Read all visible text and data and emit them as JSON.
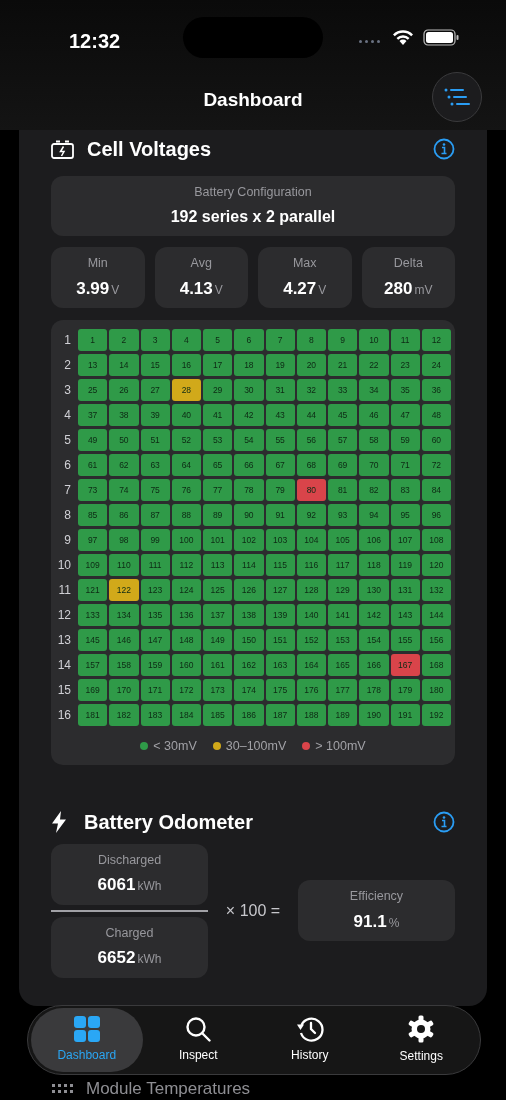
{
  "status_bar": {
    "time": "12:32"
  },
  "nav": {
    "title": "Dashboard"
  },
  "cell_voltages": {
    "title": "Cell Voltages",
    "configuration": {
      "label": "Battery Configuration",
      "value": "192 series x 2 parallel"
    },
    "stats": [
      {
        "label": "Min",
        "value": "3.99",
        "unit": "V"
      },
      {
        "label": "Avg",
        "value": "4.13",
        "unit": "V"
      },
      {
        "label": "Max",
        "value": "4.27",
        "unit": "V"
      },
      {
        "label": "Delta",
        "value": "280",
        "unit": "mV"
      }
    ],
    "grid": {
      "rows": [
        {
          "label": "1",
          "cells": [
            {
              "label": "1",
              "color": "#2f9a48"
            },
            {
              "label": "2",
              "color": "#2f9a48"
            },
            {
              "label": "3",
              "color": "#2f9a48"
            },
            {
              "label": "4",
              "color": "#2f9a48"
            },
            {
              "label": "5",
              "color": "#2f9a48"
            },
            {
              "label": "6",
              "color": "#2f9a48"
            },
            {
              "label": "7",
              "color": "#2f9a48"
            },
            {
              "label": "8",
              "color": "#2f9a48"
            },
            {
              "label": "9",
              "color": "#2f9a48"
            },
            {
              "label": "10",
              "color": "#2f9a48"
            },
            {
              "label": "11",
              "color": "#2f9a48"
            },
            {
              "label": "12",
              "color": "#2f9a48"
            }
          ]
        },
        {
          "label": "2",
          "cells": [
            {
              "label": "13",
              "color": "#2f9a48"
            },
            {
              "label": "14",
              "color": "#2f9a48"
            },
            {
              "label": "15",
              "color": "#2f9a48"
            },
            {
              "label": "16",
              "color": "#2f9a48"
            },
            {
              "label": "17",
              "color": "#2f9a48"
            },
            {
              "label": "18",
              "color": "#2f9a48"
            },
            {
              "label": "19",
              "color": "#2f9a48"
            },
            {
              "label": "20",
              "color": "#2f9a48"
            },
            {
              "label": "21",
              "color": "#2f9a48"
            },
            {
              "label": "22",
              "color": "#2f9a48"
            },
            {
              "label": "23",
              "color": "#2f9a48"
            },
            {
              "label": "24",
              "color": "#2f9a48"
            }
          ]
        },
        {
          "label": "3",
          "cells": [
            {
              "label": "25",
              "color": "#2f9a48"
            },
            {
              "label": "26",
              "color": "#2f9a48"
            },
            {
              "label": "27",
              "color": "#2f9a48"
            },
            {
              "label": "28",
              "color": "#d1a91a"
            },
            {
              "label": "29",
              "color": "#2f9a48"
            },
            {
              "label": "30",
              "color": "#2f9a48"
            },
            {
              "label": "31",
              "color": "#2f9a48"
            },
            {
              "label": "32",
              "color": "#2f9a48"
            },
            {
              "label": "33",
              "color": "#2f9a48"
            },
            {
              "label": "34",
              "color": "#2f9a48"
            },
            {
              "label": "35",
              "color": "#2f9a48"
            },
            {
              "label": "36",
              "color": "#2f9a48"
            }
          ]
        },
        {
          "label": "4",
          "cells": [
            {
              "label": "37",
              "color": "#2f9a48"
            },
            {
              "label": "38",
              "color": "#2f9a48"
            },
            {
              "label": "39",
              "color": "#2f9a48"
            },
            {
              "label": "40",
              "color": "#2f9a48"
            },
            {
              "label": "41",
              "color": "#2f9a48"
            },
            {
              "label": "42",
              "color": "#2f9a48"
            },
            {
              "label": "43",
              "color": "#2f9a48"
            },
            {
              "label": "44",
              "color": "#2f9a48"
            },
            {
              "label": "45",
              "color": "#2f9a48"
            },
            {
              "label": "46",
              "color": "#2f9a48"
            },
            {
              "label": "47",
              "color": "#2f9a48"
            },
            {
              "label": "48",
              "color": "#2f9a48"
            }
          ]
        },
        {
          "label": "5",
          "cells": [
            {
              "label": "49",
              "color": "#2f9a48"
            },
            {
              "label": "50",
              "color": "#2f9a48"
            },
            {
              "label": "51",
              "color": "#2f9a48"
            },
            {
              "label": "52",
              "color": "#2f9a48"
            },
            {
              "label": "53",
              "color": "#2f9a48"
            },
            {
              "label": "54",
              "color": "#2f9a48"
            },
            {
              "label": "55",
              "color": "#2f9a48"
            },
            {
              "label": "56",
              "color": "#2f9a48"
            },
            {
              "label": "57",
              "color": "#2f9a48"
            },
            {
              "label": "58",
              "color": "#2f9a48"
            },
            {
              "label": "59",
              "color": "#2f9a48"
            },
            {
              "label": "60",
              "color": "#2f9a48"
            }
          ]
        },
        {
          "label": "6",
          "cells": [
            {
              "label": "61",
              "color": "#2f9a48"
            },
            {
              "label": "62",
              "color": "#2f9a48"
            },
            {
              "label": "63",
              "color": "#2f9a48"
            },
            {
              "label": "64",
              "color": "#2f9a48"
            },
            {
              "label": "65",
              "color": "#2f9a48"
            },
            {
              "label": "66",
              "color": "#2f9a48"
            },
            {
              "label": "67",
              "color": "#2f9a48"
            },
            {
              "label": "68",
              "color": "#2f9a48"
            },
            {
              "label": "69",
              "color": "#2f9a48"
            },
            {
              "label": "70",
              "color": "#2f9a48"
            },
            {
              "label": "71",
              "color": "#2f9a48"
            },
            {
              "label": "72",
              "color": "#2f9a48"
            }
          ]
        },
        {
          "label": "7",
          "cells": [
            {
              "label": "73",
              "color": "#2f9a48"
            },
            {
              "label": "74",
              "color": "#2f9a48"
            },
            {
              "label": "75",
              "color": "#2f9a48"
            },
            {
              "label": "76",
              "color": "#2f9a48"
            },
            {
              "label": "77",
              "color": "#2f9a48"
            },
            {
              "label": "78",
              "color": "#2f9a48"
            },
            {
              "label": "79",
              "color": "#2f9a48"
            },
            {
              "label": "80",
              "color": "#d9444a"
            },
            {
              "label": "81",
              "color": "#2f9a48"
            },
            {
              "label": "82",
              "color": "#2f9a48"
            },
            {
              "label": "83",
              "color": "#2f9a48"
            },
            {
              "label": "84",
              "color": "#2f9a48"
            }
          ]
        },
        {
          "label": "8",
          "cells": [
            {
              "label": "85",
              "color": "#2f9a48"
            },
            {
              "label": "86",
              "color": "#2f9a48"
            },
            {
              "label": "87",
              "color": "#2f9a48"
            },
            {
              "label": "88",
              "color": "#2f9a48"
            },
            {
              "label": "89",
              "color": "#2f9a48"
            },
            {
              "label": "90",
              "color": "#2f9a48"
            },
            {
              "label": "91",
              "color": "#2f9a48"
            },
            {
              "label": "92",
              "color": "#2f9a48"
            },
            {
              "label": "93",
              "color": "#2f9a48"
            },
            {
              "label": "94",
              "color": "#2f9a48"
            },
            {
              "label": "95",
              "color": "#2f9a48"
            },
            {
              "label": "96",
              "color": "#2f9a48"
            }
          ]
        },
        {
          "label": "9",
          "cells": [
            {
              "label": "97",
              "color": "#2f9a48"
            },
            {
              "label": "98",
              "color": "#2f9a48"
            },
            {
              "label": "99",
              "color": "#2f9a48"
            },
            {
              "label": "100",
              "color": "#2f9a48"
            },
            {
              "label": "101",
              "color": "#2f9a48"
            },
            {
              "label": "102",
              "color": "#2f9a48"
            },
            {
              "label": "103",
              "color": "#2f9a48"
            },
            {
              "label": "104",
              "color": "#2f9a48"
            },
            {
              "label": "105",
              "color": "#2f9a48"
            },
            {
              "label": "106",
              "color": "#2f9a48"
            },
            {
              "label": "107",
              "color": "#2f9a48"
            },
            {
              "label": "108",
              "color": "#2f9a48"
            }
          ]
        },
        {
          "label": "10",
          "cells": [
            {
              "label": "109",
              "color": "#2f9a48"
            },
            {
              "label": "110",
              "color": "#2f9a48"
            },
            {
              "label": "111",
              "color": "#2f9a48"
            },
            {
              "label": "112",
              "color": "#2f9a48"
            },
            {
              "label": "113",
              "color": "#2f9a48"
            },
            {
              "label": "114",
              "color": "#2f9a48"
            },
            {
              "label": "115",
              "color": "#2f9a48"
            },
            {
              "label": "116",
              "color": "#2f9a48"
            },
            {
              "label": "117",
              "color": "#2f9a48"
            },
            {
              "label": "118",
              "color": "#2f9a48"
            },
            {
              "label": "119",
              "color": "#2f9a48"
            },
            {
              "label": "120",
              "color": "#2f9a48"
            }
          ]
        },
        {
          "label": "11",
          "cells": [
            {
              "label": "121",
              "color": "#2f9a48"
            },
            {
              "label": "122",
              "color": "#d1a91a"
            },
            {
              "label": "123",
              "color": "#2f9a48"
            },
            {
              "label": "124",
              "color": "#2f9a48"
            },
            {
              "label": "125",
              "color": "#2f9a48"
            },
            {
              "label": "126",
              "color": "#2f9a48"
            },
            {
              "label": "127",
              "color": "#2f9a48"
            },
            {
              "label": "128",
              "color": "#2f9a48"
            },
            {
              "label": "129",
              "color": "#2f9a48"
            },
            {
              "label": "130",
              "color": "#2f9a48"
            },
            {
              "label": "131",
              "color": "#2f9a48"
            },
            {
              "label": "132",
              "color": "#2f9a48"
            }
          ]
        },
        {
          "label": "12",
          "cells": [
            {
              "label": "133",
              "color": "#2f9a48"
            },
            {
              "label": "134",
              "color": "#2f9a48"
            },
            {
              "label": "135",
              "color": "#2f9a48"
            },
            {
              "label": "136",
              "color": "#2f9a48"
            },
            {
              "label": "137",
              "color": "#2f9a48"
            },
            {
              "label": "138",
              "color": "#2f9a48"
            },
            {
              "label": "139",
              "color": "#2f9a48"
            },
            {
              "label": "140",
              "color": "#2f9a48"
            },
            {
              "label": "141",
              "color": "#2f9a48"
            },
            {
              "label": "142",
              "color": "#2f9a48"
            },
            {
              "label": "143",
              "color": "#2f9a48"
            },
            {
              "label": "144",
              "color": "#2f9a48"
            }
          ]
        },
        {
          "label": "13",
          "cells": [
            {
              "label": "145",
              "color": "#2f9a48"
            },
            {
              "label": "146",
              "color": "#2f9a48"
            },
            {
              "label": "147",
              "color": "#2f9a48"
            },
            {
              "label": "148",
              "color": "#2f9a48"
            },
            {
              "label": "149",
              "color": "#2f9a48"
            },
            {
              "label": "150",
              "color": "#2f9a48"
            },
            {
              "label": "151",
              "color": "#2f9a48"
            },
            {
              "label": "152",
              "color": "#2f9a48"
            },
            {
              "label": "153",
              "color": "#2f9a48"
            },
            {
              "label": "154",
              "color": "#2f9a48"
            },
            {
              "label": "155",
              "color": "#2f9a48"
            },
            {
              "label": "156",
              "color": "#2f9a48"
            }
          ]
        },
        {
          "label": "14",
          "cells": [
            {
              "label": "157",
              "color": "#2f9a48"
            },
            {
              "label": "158",
              "color": "#2f9a48"
            },
            {
              "label": "159",
              "color": "#2f9a48"
            },
            {
              "label": "160",
              "color": "#2f9a48"
            },
            {
              "label": "161",
              "color": "#2f9a48"
            },
            {
              "label": "162",
              "color": "#2f9a48"
            },
            {
              "label": "163",
              "color": "#2f9a48"
            },
            {
              "label": "164",
              "color": "#2f9a48"
            },
            {
              "label": "165",
              "color": "#2f9a48"
            },
            {
              "label": "166",
              "color": "#2f9a48"
            },
            {
              "label": "167",
              "color": "#d9444a"
            },
            {
              "label": "168",
              "color": "#2f9a48"
            }
          ]
        },
        {
          "label": "15",
          "cells": [
            {
              "label": "169",
              "color": "#2f9a48"
            },
            {
              "label": "170",
              "color": "#2f9a48"
            },
            {
              "label": "171",
              "color": "#2f9a48"
            },
            {
              "label": "172",
              "color": "#2f9a48"
            },
            {
              "label": "173",
              "color": "#2f9a48"
            },
            {
              "label": "174",
              "color": "#2f9a48"
            },
            {
              "label": "175",
              "color": "#2f9a48"
            },
            {
              "label": "176",
              "color": "#2f9a48"
            },
            {
              "label": "177",
              "color": "#2f9a48"
            },
            {
              "label": "178",
              "color": "#2f9a48"
            },
            {
              "label": "179",
              "color": "#2f9a48"
            },
            {
              "label": "180",
              "color": "#2f9a48"
            }
          ]
        },
        {
          "label": "16",
          "cells": [
            {
              "label": "181",
              "color": "#2f9a48"
            },
            {
              "label": "182",
              "color": "#2f9a48"
            },
            {
              "label": "183",
              "color": "#2f9a48"
            },
            {
              "label": "184",
              "color": "#2f9a48"
            },
            {
              "label": "185",
              "color": "#2f9a48"
            },
            {
              "label": "186",
              "color": "#2f9a48"
            },
            {
              "label": "187",
              "color": "#2f9a48"
            },
            {
              "label": "188",
              "color": "#2f9a48"
            },
            {
              "label": "189",
              "color": "#2f9a48"
            },
            {
              "label": "190",
              "color": "#2f9a48"
            },
            {
              "label": "191",
              "color": "#2f9a48"
            },
            {
              "label": "192",
              "color": "#2f9a48"
            }
          ]
        }
      ],
      "legend": [
        {
          "label": "< 30mV",
          "color": "#2f9a48"
        },
        {
          "label": "30–100mV",
          "color": "#d1a91a"
        },
        {
          "label": "> 100mV",
          "color": "#d9444a"
        }
      ]
    }
  },
  "odometer": {
    "title": "Battery Odometer",
    "discharged": {
      "label": "Discharged",
      "value": "6061",
      "unit": "kWh"
    },
    "charged": {
      "label": "Charged",
      "value": "6652",
      "unit": "kWh"
    },
    "operator": "× 100 =",
    "efficiency": {
      "label": "Efficiency",
      "value": "91.1",
      "unit": "%"
    }
  },
  "next_section": {
    "title": "Module Temperatures"
  },
  "tab_bar": [
    {
      "label": "Dashboard",
      "selected": true
    },
    {
      "label": "Inspect",
      "selected": false
    },
    {
      "label": "History",
      "selected": false
    },
    {
      "label": "Settings",
      "selected": false
    }
  ]
}
